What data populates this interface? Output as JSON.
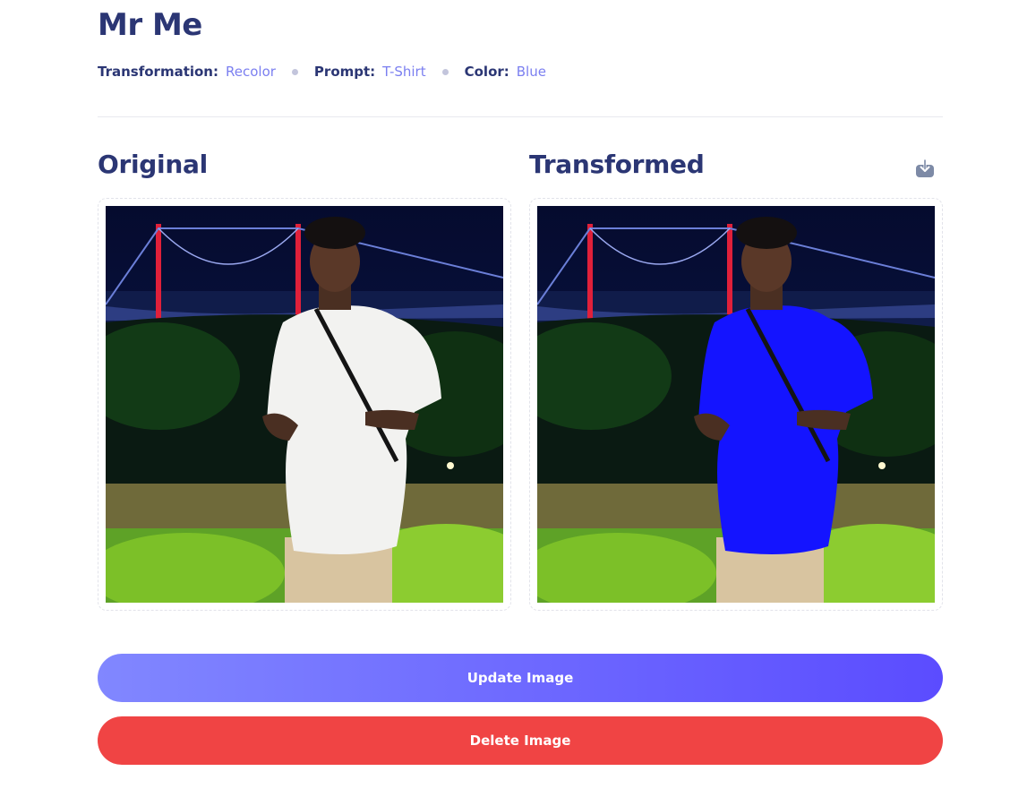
{
  "page": {
    "title": "Mr Me"
  },
  "meta": [
    {
      "key": "Transformation:",
      "value": "Recolor"
    },
    {
      "key": "Prompt:",
      "value": "T-Shirt"
    },
    {
      "key": "Color:",
      "value": "Blue"
    }
  ],
  "original": {
    "heading": "Original"
  },
  "transformed": {
    "heading": "Transformed",
    "download_icon": "download-icon"
  },
  "actions": {
    "update_label": "Update Image",
    "delete_label": "Delete Image"
  },
  "colors": {
    "title": "#2b3674",
    "accent": "#7b7ff0",
    "update_from": "#8187ff",
    "update_to": "#5b4cff",
    "delete": "#f04444",
    "shirt_original": "#f2f2f0",
    "shirt_transformed": "#1414ff"
  }
}
